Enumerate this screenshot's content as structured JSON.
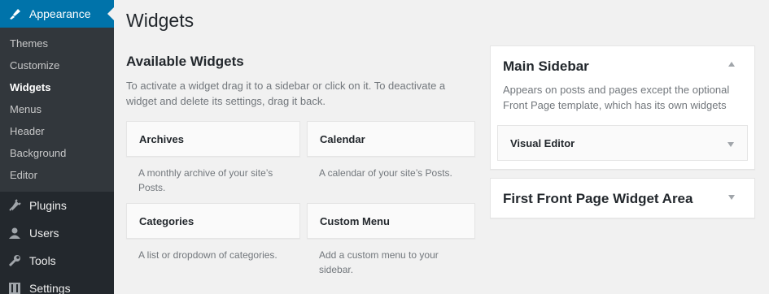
{
  "sidebar": {
    "active": {
      "label": "Appearance",
      "icon": "paintbrush-icon"
    },
    "submenu": [
      "Themes",
      "Customize",
      "Widgets",
      "Menus",
      "Header",
      "Background",
      "Editor"
    ],
    "current": "Widgets",
    "items": [
      {
        "label": "Plugins",
        "icon": "plugin-icon"
      },
      {
        "label": "Users",
        "icon": "users-icon"
      },
      {
        "label": "Tools",
        "icon": "wrench-icon"
      },
      {
        "label": "Settings",
        "icon": "settings-icon"
      }
    ]
  },
  "main": {
    "title": "Widgets",
    "available": {
      "title": "Available Widgets",
      "description": "To activate a widget drag it to a sidebar or click on it. To deactivate a widget and delete its settings, drag it back."
    },
    "widgets": [
      {
        "title": "Archives",
        "description": "A monthly archive of your site’s Posts."
      },
      {
        "title": "Calendar",
        "description": "A calendar of your site’s Posts."
      },
      {
        "title": "Categories",
        "description": "A list or dropdown of categories."
      },
      {
        "title": "Custom Menu",
        "description": "Add a custom menu to your sidebar."
      }
    ]
  },
  "areas": {
    "main_sidebar": {
      "title": "Main Sidebar",
      "description": "Appears on posts and pages except the optional Front Page template, which has its own widgets",
      "widget": "Visual Editor"
    },
    "first_front": {
      "title": "First Front Page Widget Area"
    }
  },
  "colors": {
    "sidebar_bg": "#23282d",
    "accent": "#0073aa",
    "page_bg": "#f1f1f1"
  }
}
